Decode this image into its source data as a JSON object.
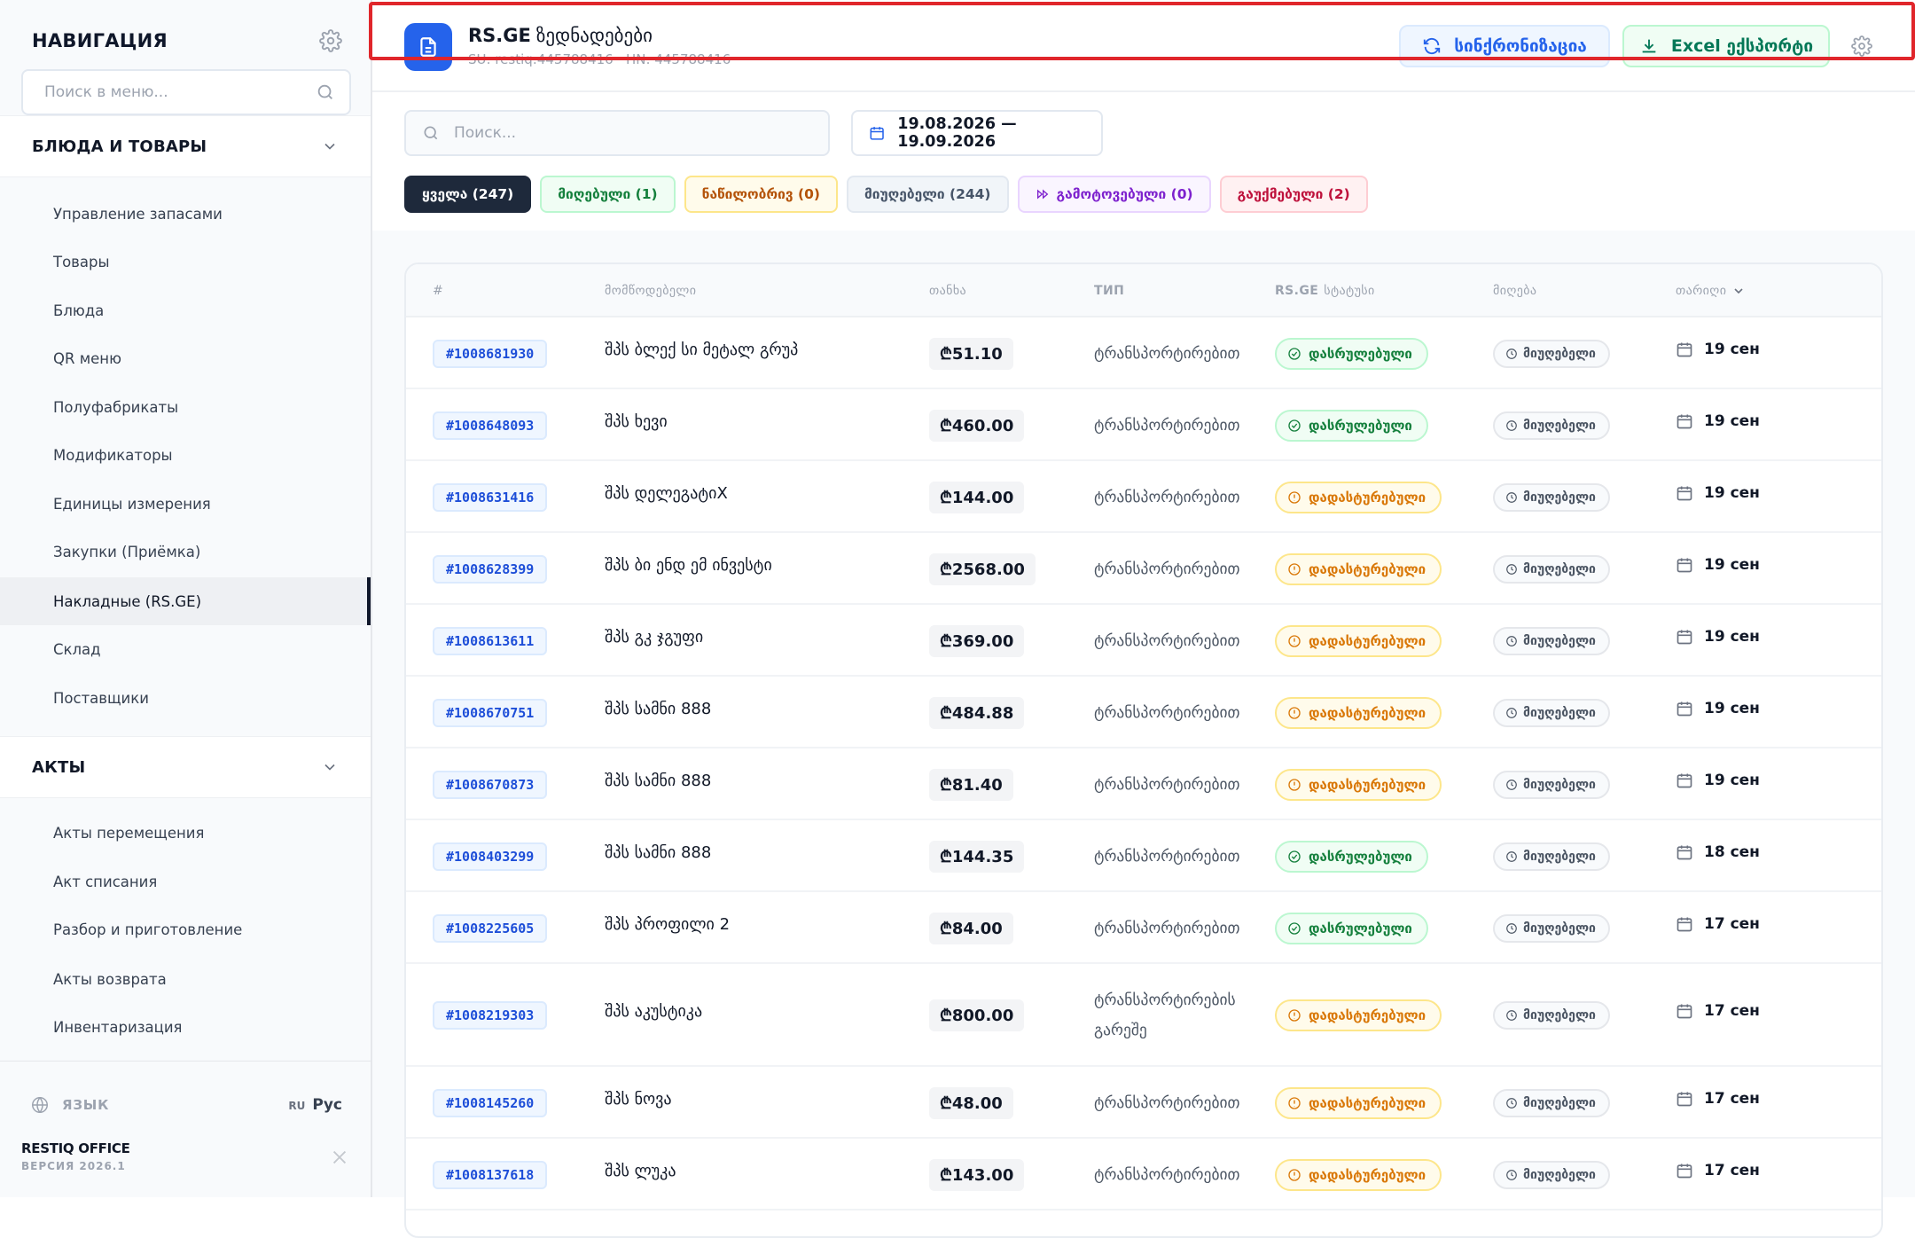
{
  "sidebar": {
    "title": "НАВИГАЦИЯ",
    "search_placeholder": "Поиск в меню...",
    "groups": [
      {
        "label": "БЛЮДА И ТОВАРЫ"
      },
      {
        "label": "АКТЫ"
      }
    ],
    "items_goods": [
      {
        "label": "Управление запасами"
      },
      {
        "label": "Товары"
      },
      {
        "label": "Блюда"
      },
      {
        "label": "QR меню"
      },
      {
        "label": "Полуфабрикаты"
      },
      {
        "label": "Модификаторы"
      },
      {
        "label": "Единицы измерения"
      },
      {
        "label": "Закупки (Приёмка)"
      },
      {
        "label": "Накладные (RS.GE)"
      },
      {
        "label": "Склад"
      },
      {
        "label": "Поставщики"
      }
    ],
    "active_item": "Накладные (RS.GE)",
    "items_acts": [
      {
        "label": "Акты перемещения"
      },
      {
        "label": "Акт списания"
      },
      {
        "label": "Разбор и приготовление"
      },
      {
        "label": "Акты возврата"
      },
      {
        "label": "Инвентаризация"
      }
    ],
    "language_label": "ЯЗЫК",
    "language_code": "RU",
    "language_name": "Рус",
    "brand_name": "RESTIQ OFFICE",
    "brand_version": "ВЕРСИЯ 2026.1"
  },
  "topbar": {
    "brand": "RS.GE",
    "title": "ზედნადებები",
    "subtitle": "SU: restiq:445788416 · HN: 445788416",
    "sync_label": "სინქრონიზაცია",
    "excel_label": "Excel ექსპორტი"
  },
  "filters": {
    "search_placeholder": "Поиск...",
    "date_range": "19.08.2026 — 19.09.2026",
    "pills": {
      "all": "ყველა (247)",
      "received": "მიღებული (1)",
      "partial": "ნაწილობრივ (0)",
      "not_received": "მიუღებელი (244)",
      "transferred": "გამოტოვებული (0)",
      "cancelled": "გაუქმებული (2)"
    }
  },
  "table": {
    "headers": {
      "id": "#",
      "supplier": "მომწოდებელი",
      "amount": "თანხა",
      "type": "ТИП",
      "status_brand": "RS.GE",
      "status": "სტატუსი",
      "receiving": "მიღება",
      "date": "თარიღი"
    },
    "rows": [
      {
        "id": "#1008681930",
        "supplier": "შპს ბლექ სი მეტალ გრუპ",
        "amount": "₾51.10",
        "type": "ტრანსპორტირებით",
        "status": "დასრულებული",
        "status_kind": "done",
        "receiving": "მიუღებელი",
        "date": "19 сен"
      },
      {
        "id": "#1008648093",
        "supplier": "შპს ხევი",
        "amount": "₾460.00",
        "type": "ტრანსპორტირებით",
        "status": "დასრულებული",
        "status_kind": "done",
        "receiving": "მიუღებელი",
        "date": "19 сен"
      },
      {
        "id": "#1008631416",
        "supplier": "შპს დელეგატიX",
        "amount": "₾144.00",
        "type": "ტრანსპორტირებით",
        "status": "დადასტურებული",
        "status_kind": "conf",
        "receiving": "მიუღებელი",
        "date": "19 сен"
      },
      {
        "id": "#1008628399",
        "supplier": "შპს ბი ენდ ემ ინვესტი",
        "amount": "₾2568.00",
        "type": "ტრანსპორტირებით",
        "status": "დადასტურებული",
        "status_kind": "conf",
        "receiving": "მიუღებელი",
        "date": "19 сен"
      },
      {
        "id": "#1008613611",
        "supplier": "შპს გკ ჯგუფი",
        "amount": "₾369.00",
        "type": "ტრანსპორტირებით",
        "status": "დადასტურებული",
        "status_kind": "conf",
        "receiving": "მიუღებელი",
        "date": "19 сен"
      },
      {
        "id": "#1008670751",
        "supplier": "შპს სამნი 888",
        "amount": "₾484.88",
        "type": "ტრანსპორტირებით",
        "status": "დადასტურებული",
        "status_kind": "conf",
        "receiving": "მიუღებელი",
        "date": "19 сен"
      },
      {
        "id": "#1008670873",
        "supplier": "შპს სამნი 888",
        "amount": "₾81.40",
        "type": "ტრანსპორტირებით",
        "status": "დადასტურებული",
        "status_kind": "conf",
        "receiving": "მიუღებელი",
        "date": "19 сен"
      },
      {
        "id": "#1008403299",
        "supplier": "შპს სამნი 888",
        "amount": "₾144.35",
        "type": "ტრანსპორტირებით",
        "status": "დასრულებული",
        "status_kind": "done",
        "receiving": "მიუღებელი",
        "date": "18 сен"
      },
      {
        "id": "#1008225605",
        "supplier": "შპს პროფილი 2",
        "amount": "₾84.00",
        "type": "ტრანსპორტირებით",
        "status": "დასრულებული",
        "status_kind": "done",
        "receiving": "მიუღებელი",
        "date": "17 сен"
      },
      {
        "id": "#1008219303",
        "supplier": "შპს აკუსტიკა",
        "amount": "₾800.00",
        "type": "ტრანსპორტირების გარეშე",
        "status": "დადასტურებული",
        "status_kind": "conf",
        "receiving": "მიუღებელი",
        "date": "17 сен"
      },
      {
        "id": "#1008145260",
        "supplier": "შპს ნოვა",
        "amount": "₾48.00",
        "type": "ტრანსპორტირებით",
        "status": "დადასტურებული",
        "status_kind": "conf",
        "receiving": "მიუღებელი",
        "date": "17 сен"
      },
      {
        "id": "#1008137618",
        "supplier": "შპს ლუკა",
        "amount": "₾143.00",
        "type": "ტრანსპორტირებით",
        "status": "დადასტურებული",
        "status_kind": "conf",
        "receiving": "მიუღებელი",
        "date": "17 сен"
      }
    ]
  },
  "colors": {
    "accent_blue": "#2563eb",
    "success_green": "#15803d",
    "warning_amber": "#d97706",
    "highlight_red": "#e0262b"
  },
  "icons": {
    "sidebar_settings": "gear-icon",
    "menu_search": "search-icon",
    "group_toggle": "chevron-down-icon",
    "language": "globe-icon",
    "close": "close-icon",
    "logo": "document-icon",
    "sync": "refresh-icon",
    "export": "download-icon",
    "date_picker": "calendar-icon",
    "transferred": "fast-forward-icon",
    "status_done": "check-circle-icon",
    "status_confirmed": "alert-circle-icon",
    "receiving": "clock-icon"
  }
}
